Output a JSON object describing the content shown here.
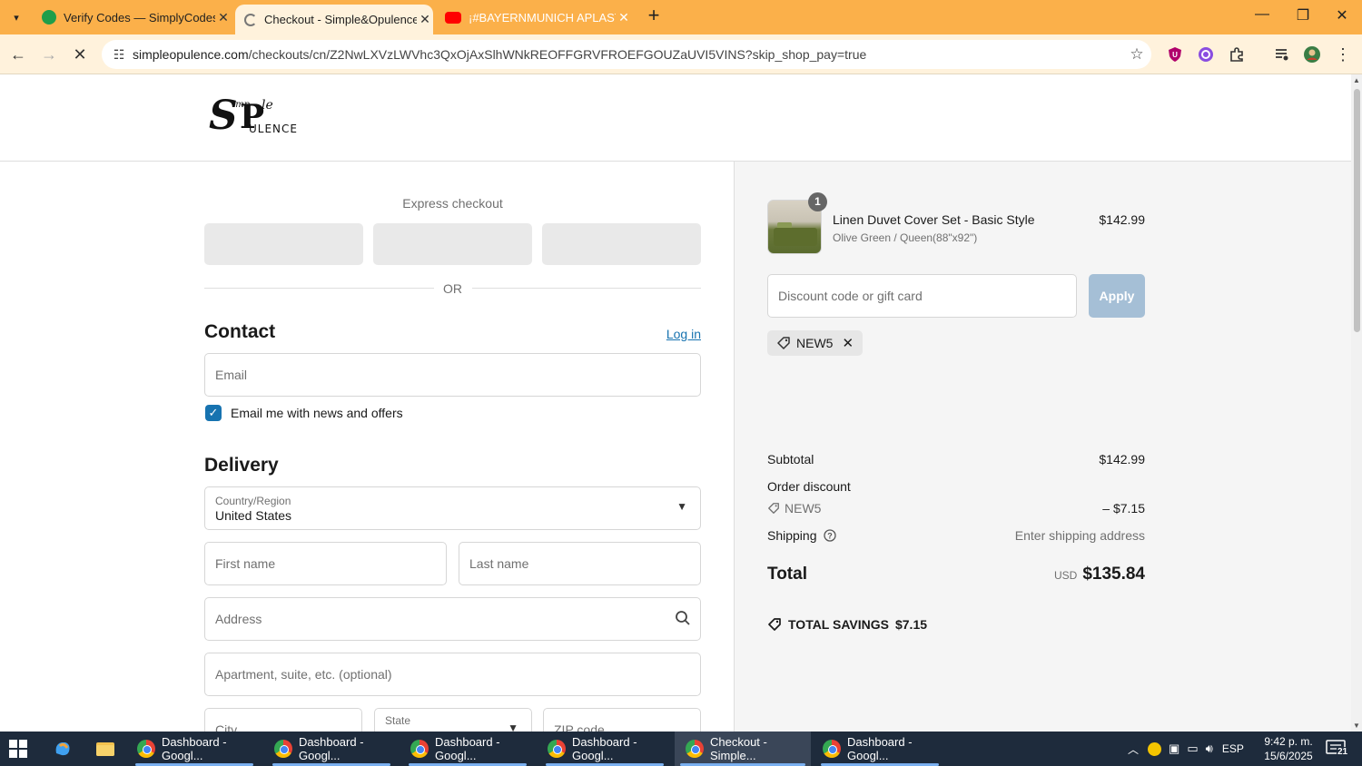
{
  "browser": {
    "tabs": [
      {
        "title": "Verify Codes — SimplyCodes",
        "active": false
      },
      {
        "title": "Checkout - Simple&Opulence",
        "active": true
      },
      {
        "title": "¡#BAYERNMUNICH APLASTÓ a",
        "active": false
      }
    ],
    "url_host": "simpleopulence.com",
    "url_path": "/checkouts/cn/Z2NwLXVzLWVhc3QxOjAxSlhWNkREOFFGRVFROEFGOUZaUVI5VINS?skip_shop_pay=true",
    "colors": {
      "tabstrip": "#fbb04a",
      "toolbar": "#fff2dc"
    }
  },
  "header": {
    "logo_text": "Simple Opulence"
  },
  "express": {
    "title": "Express checkout",
    "or_text": "OR"
  },
  "contact": {
    "heading": "Contact",
    "login_link": "Log in",
    "email_placeholder": "Email",
    "news_checkbox_label": "Email me with news and offers",
    "news_checked": true
  },
  "delivery": {
    "heading": "Delivery",
    "country_label": "Country/Region",
    "country_value": "United States",
    "first_name_placeholder": "First name",
    "last_name_placeholder": "Last name",
    "address_placeholder": "Address",
    "apartment_placeholder": "Apartment, suite, etc. (optional)",
    "city_placeholder": "City",
    "state_label": "State",
    "zip_placeholder": "ZIP code"
  },
  "summary": {
    "product": {
      "name": "Linen Duvet Cover Set - Basic Style",
      "variant": "Olive Green / Queen(88\"x92\")",
      "price": "$142.99",
      "quantity": "1"
    },
    "discount_placeholder": "Discount code or gift card",
    "apply_label": "Apply",
    "applied_code": "NEW5",
    "subtotal_label": "Subtotal",
    "subtotal_value": "$142.99",
    "order_discount_label": "Order discount",
    "discount_code": "NEW5",
    "discount_value": "– $7.15",
    "shipping_label": "Shipping",
    "shipping_value": "Enter shipping address",
    "total_label": "Total",
    "currency": "USD",
    "total_value": "$135.84",
    "savings_label": "TOTAL SAVINGS",
    "savings_value": "$7.15"
  },
  "taskbar": {
    "items": [
      {
        "title": "Dashboard - Googl...",
        "active": false
      },
      {
        "title": "Dashboard - Googl...",
        "active": false
      },
      {
        "title": "Dashboard - Googl...",
        "active": false
      },
      {
        "title": "Dashboard - Googl...",
        "active": false
      },
      {
        "title": "Checkout - Simple...",
        "active": true
      },
      {
        "title": "Dashboard - Googl...",
        "active": false
      }
    ],
    "language": "ESP",
    "time": "9:42 p. m.",
    "date": "15/6/2025",
    "notifications": "21"
  }
}
